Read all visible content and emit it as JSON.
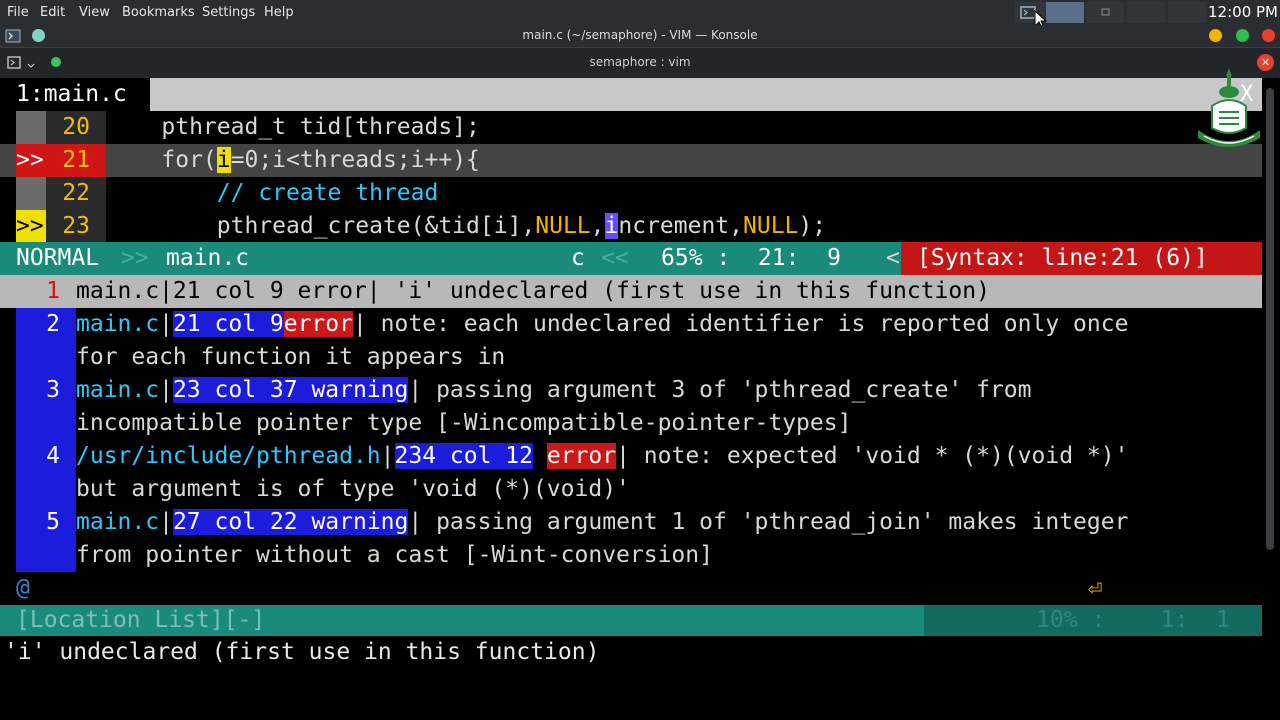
{
  "menubar": {
    "items": [
      "File",
      "Edit",
      "View",
      "Bookmarks",
      "Settings",
      "Help"
    ],
    "clock": "12:00 PM"
  },
  "window": {
    "title": "main.c (~/semaphore) - VIM — Konsole",
    "tab_title": "semaphore : vim"
  },
  "vim": {
    "tab_label": "1:main.c",
    "tab_close": "X",
    "code": [
      {
        "sign": "",
        "num": "20",
        "text": "    pthread_t tid[threads];"
      },
      {
        "sign": ">>",
        "num": "21",
        "pre": "    for(",
        "cursor": "i",
        "post": "=0;i<threads;i++){"
      },
      {
        "sign": "",
        "num": "22",
        "text": "        // create thread"
      },
      {
        "sign": ">>",
        "num": "23",
        "pre": "        pthread_create(&tid[i],",
        "null1": "NULL",
        "comma": ",",
        "cursor": "i",
        "mid": "ncrement,",
        "null2": "NULL",
        "post": ");"
      }
    ],
    "status": {
      "mode": "NORMAL",
      "sep1": ">>",
      "file": "main.c",
      "filetype": "c",
      "sep2": "<<",
      "position": "65% :  21:  9",
      "sep3": "<",
      "syntax": "[Syntax: line:21 (6)]"
    },
    "quickfix": [
      {
        "num": "1",
        "line1": "main.c|21 col 9 error| 'i' undeclared (first use in this function)"
      },
      {
        "num": "2",
        "file": "main.c",
        "pos": "21 col 9",
        "type": "error",
        "msg": "| note: each undeclared identifier is reported only once",
        "cont": "for each function it appears in"
      },
      {
        "num": "3",
        "file": "main.c",
        "pos": "23 col 37",
        "type": "warning",
        "msg": "| passing argument 3 of 'pthread_create' from",
        "cont": "incompatible pointer type [-Wincompatible-pointer-types]"
      },
      {
        "num": "4",
        "file": "/usr/include/pthread.h",
        "pos": "234 col 12",
        "type": "error",
        "msg": "| note: expected 'void * (*)(void *)'",
        "cont": "but argument is of type 'void (*)(void)'"
      },
      {
        "num": "5",
        "file": "main.c",
        "pos": "27 col 22",
        "type": "warning",
        "msg": "| passing argument 1 of 'pthread_join' makes integer",
        "cont": "from pointer without a cast [-Wint-conversion]"
      }
    ],
    "filler": "@",
    "return_symbol": "⏎",
    "location_status": {
      "label": "[Location List][-]",
      "position": "10% :    1:  1"
    },
    "cmdline": "'i' undeclared (first use in this function)"
  },
  "colors": {
    "status_bg": "#1a8a7a",
    "error_bg": "#cc1818",
    "quickfix_num_bg": "#1c1cdc",
    "line_number": "#f0c000"
  }
}
